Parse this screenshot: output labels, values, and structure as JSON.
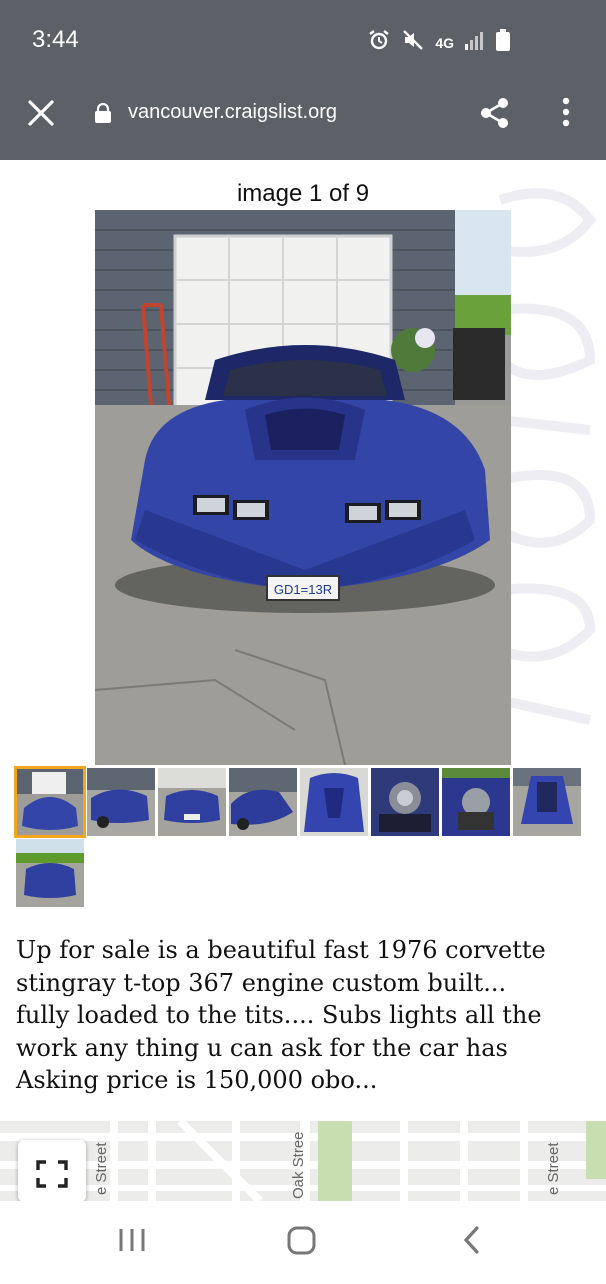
{
  "status_bar": {
    "time": "3:44",
    "network": "4G",
    "icons": [
      "alarm-icon",
      "mute-icon",
      "network-4g-icon",
      "signal-icon",
      "battery-icon"
    ]
  },
  "browser": {
    "url": "vancouver.craigslist.org",
    "icons": [
      "close-icon",
      "lock-icon",
      "share-icon",
      "more-vert-icon"
    ],
    "bar_color": "#5b6167"
  },
  "gallery": {
    "counter": "image 1 of 9",
    "selected_index": 1,
    "thumbnail_count": 9,
    "selected_color": "#f3a51c",
    "plate_text": "GD1=13R"
  },
  "description": {
    "lines": [
      "Up for sale is a beautiful fast 1976 corvette",
      "stingray t-top 367 engine custom built...",
      "fully loaded to the tits.... Subs lights all the",
      "work any thing u can ask for the car has",
      "Asking price is 150,000 obo..."
    ]
  },
  "map": {
    "street_labels": [
      "e Street",
      "Oak Stree",
      "e Street"
    ]
  },
  "nav": {
    "icons": [
      "recent-apps-icon",
      "home-icon",
      "back-icon"
    ]
  }
}
